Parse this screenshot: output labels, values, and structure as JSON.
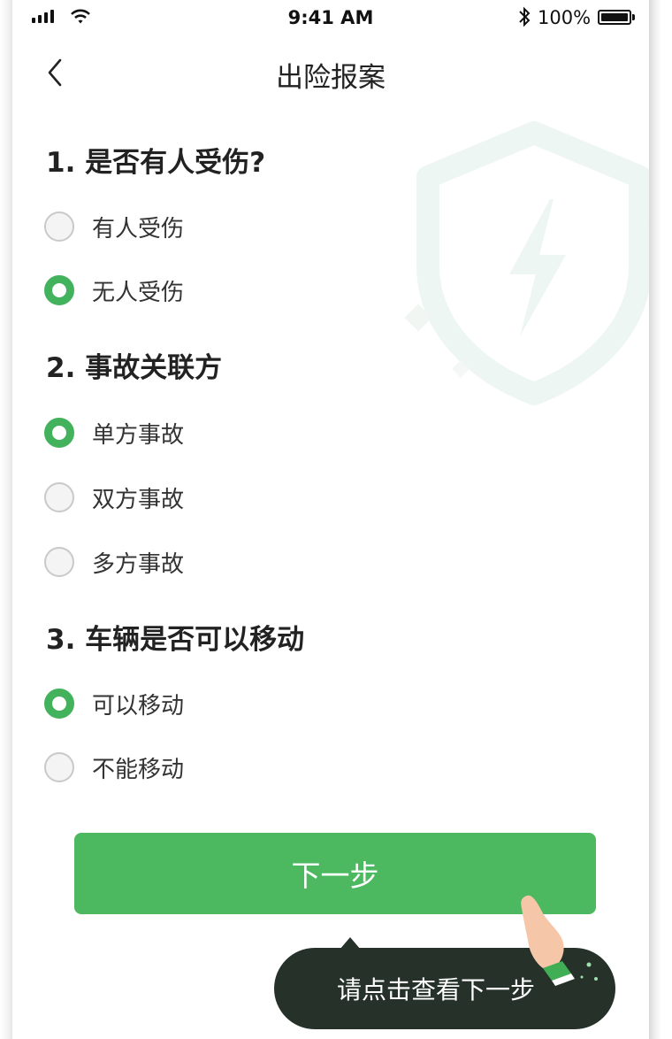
{
  "status_bar": {
    "time": "9:41 AM",
    "battery_percent": "100%",
    "icons": [
      "signal-icon",
      "wifi-icon",
      "bluetooth-icon",
      "battery-icon"
    ]
  },
  "nav": {
    "title": "出险报案",
    "back_icon": "chevron-left-icon"
  },
  "questions": [
    {
      "title": "1. 是否有人受伤?",
      "options": [
        {
          "label": "有人受伤",
          "checked": false
        },
        {
          "label": "无人受伤",
          "checked": true
        }
      ]
    },
    {
      "title": "2. 事故关联方",
      "options": [
        {
          "label": "单方事故",
          "checked": true
        },
        {
          "label": "双方事故",
          "checked": false
        },
        {
          "label": "多方事故",
          "checked": false
        }
      ]
    },
    {
      "title": "3. 车辆是否可以移动",
      "options": [
        {
          "label": "可以移动",
          "checked": true
        },
        {
          "label": "不能移动",
          "checked": false
        }
      ]
    }
  ],
  "next_button": {
    "label": "下一步"
  },
  "tooltip": {
    "text": "请点击查看下一步"
  },
  "colors": {
    "accent": "#4cb85f",
    "radio_checked": "#43b25c",
    "tooltip_bg": "#253129"
  }
}
